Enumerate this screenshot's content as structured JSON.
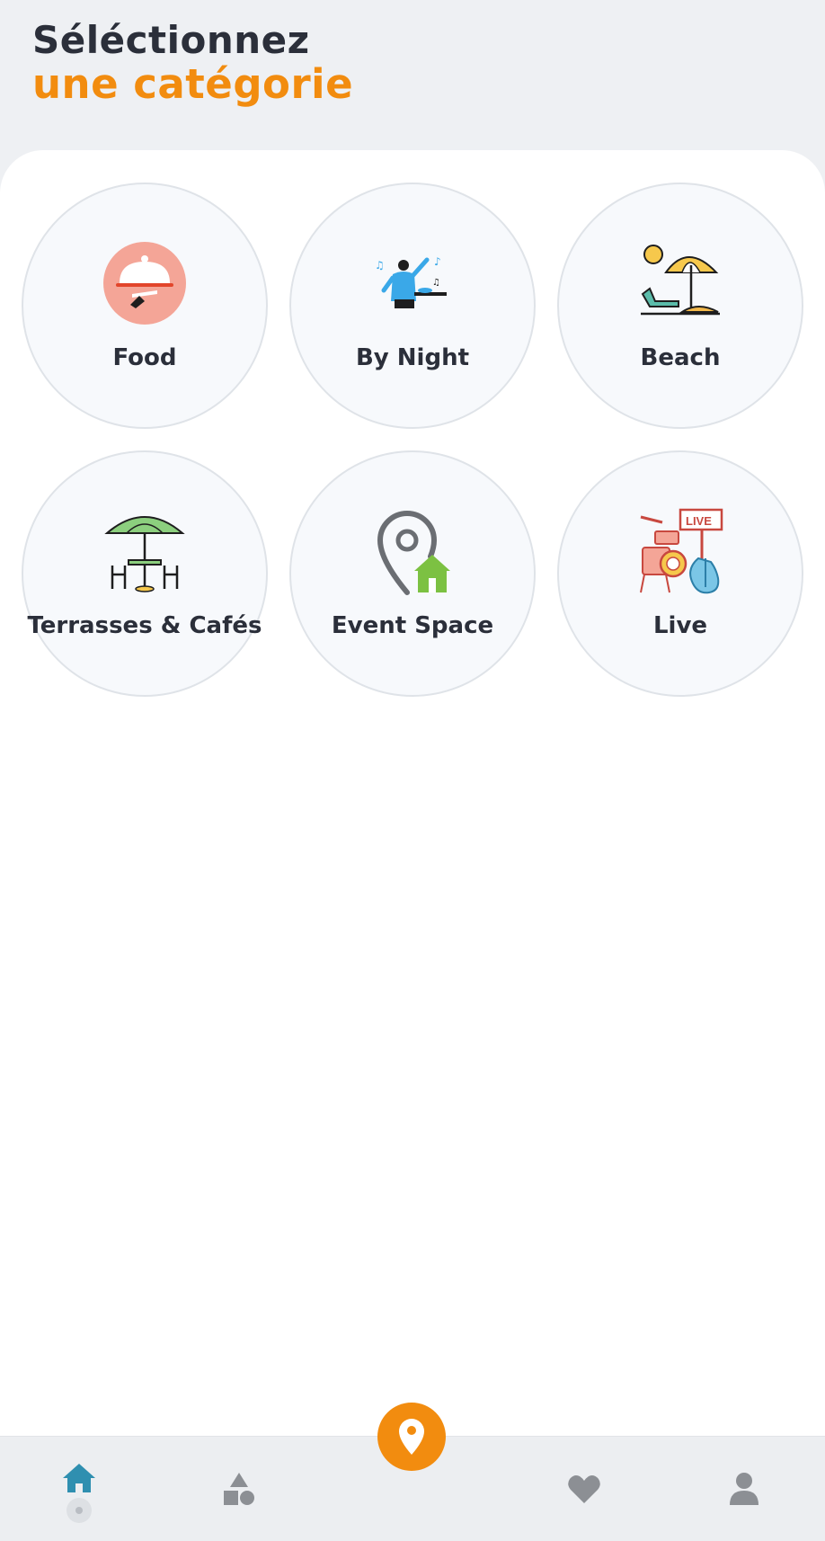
{
  "header": {
    "line1": "Séléctionnez",
    "line2": "une catégorie"
  },
  "categories": [
    {
      "label": "Food",
      "icon": "food-cloche-icon"
    },
    {
      "label": "By Night",
      "icon": "dj-nightlife-icon"
    },
    {
      "label": "Beach",
      "icon": "beach-umbrella-icon"
    },
    {
      "label": "Terrasses & Cafés",
      "icon": "terrace-table-umbrella-icon"
    },
    {
      "label": "Event Space",
      "icon": "location-home-icon"
    },
    {
      "label": "Live",
      "icon": "live-music-instruments-icon",
      "sign_text": "LIVE"
    }
  ],
  "nav": {
    "items": [
      "home-icon",
      "categories-shapes-icon",
      "map-pin-icon",
      "heart-icon",
      "profile-icon"
    ],
    "active": "home",
    "active_color": "#2f8fb0",
    "inactive_color": "#8c8f94"
  },
  "colors": {
    "accent": "#f28c0f",
    "title": "#2b2f3a"
  }
}
